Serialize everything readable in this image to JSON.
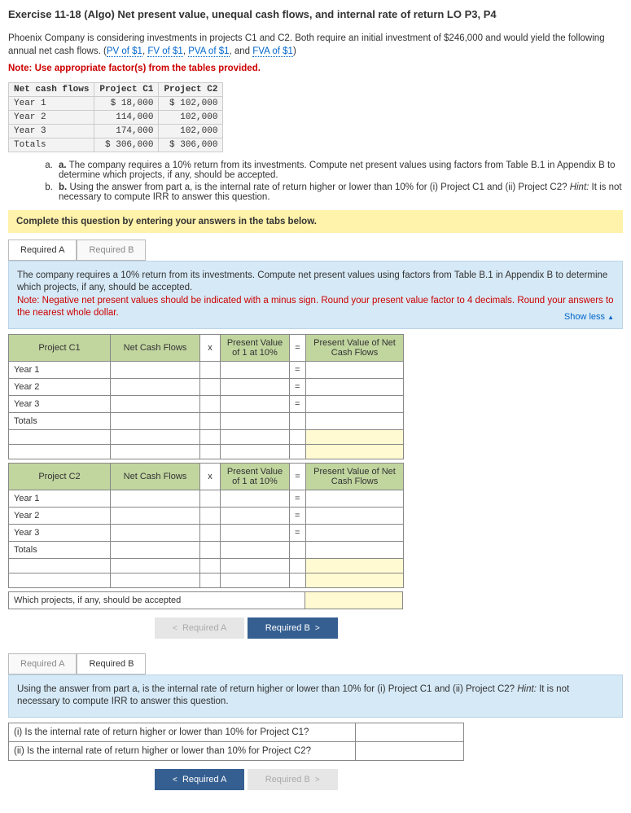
{
  "title": "Exercise 11-18 (Algo) Net present value, unequal cash flows, and internal rate of return LO P3, P4",
  "intro1": "Phoenix Company is considering investments in projects C1 and C2. Both require an initial investment of $246,000 and would yield the following annual net cash flows. (",
  "links": {
    "pv": "PV of $1",
    "fv": "FV of $1",
    "pva": "PVA of $1",
    "fva": "FVA of $1"
  },
  "and": ", and ",
  "sep": ", ",
  "close": ")",
  "note_top": "Note: Use appropriate factor(s) from the tables provided.",
  "cftable": {
    "h0": "Net cash flows",
    "h1": "Project C1",
    "h2": "Project C2",
    "r1": {
      "y": "Year 1",
      "c1": "$ 18,000",
      "c2": "$ 102,000"
    },
    "r2": {
      "y": "Year 2",
      "c1": "114,000",
      "c2": "102,000"
    },
    "r3": {
      "y": "Year 3",
      "c1": "174,000",
      "c2": "102,000"
    },
    "rt": {
      "y": "Totals",
      "c1": "$ 306,000",
      "c2": "$ 306,000"
    }
  },
  "qa": "The company requires a 10% return from its investments. Compute net present values using factors from Table B.1 in Appendix B to determine which projects, if any, should be accepted.",
  "qb1": "Using the answer from part a, is the internal rate of return higher or lower than 10% for (i) Project C1 and (ii) Project C2? ",
  "hint_label": "Hint:",
  "qb2": " It is not necessary to compute IRR to answer this question.",
  "bar": "Complete this question by entering your answers in the tabs below.",
  "tabs": {
    "a": "Required A",
    "b": "Required B"
  },
  "blueA": {
    "l1": "The company requires a 10% return from its investments. Compute net present values using factors from Table B.1 in Appendix B to determine which projects, if any, should be accepted.",
    "l2": "Note: Negative net present values should be indicated with a minus sign. Round your present value factor to 4 decimals. Round your answers to the nearest whole dollar."
  },
  "showless": "Show less",
  "ws": {
    "proj1": "Project C1",
    "proj2": "Project C2",
    "ncf": "Net Cash Flows",
    "x": "x",
    "pv": "Present Value of 1 at 10%",
    "eq": "=",
    "pvn": "Present Value of Net Cash Flows",
    "y1": "Year 1",
    "y2": "Year 2",
    "y3": "Year 3",
    "totals": "Totals",
    "accept": "Which projects, if any, should be accepted"
  },
  "navA": {
    "prev": "Required A",
    "next": "Required B"
  },
  "navB": {
    "prev": "Required A",
    "next": "Required B"
  },
  "blueB": "Using the answer from part a, is the internal rate of return higher or lower than 10% for (i) Project C1 and (ii) Project C2? ",
  "blueBhint": " It is not necessary to compute IRR to answer this question.",
  "qbtable": {
    "q1": "(i) Is the internal rate of return higher or lower than 10% for Project C1?",
    "q2": "(ii) Is the internal rate of return higher or lower than 10% for Project C2?"
  }
}
